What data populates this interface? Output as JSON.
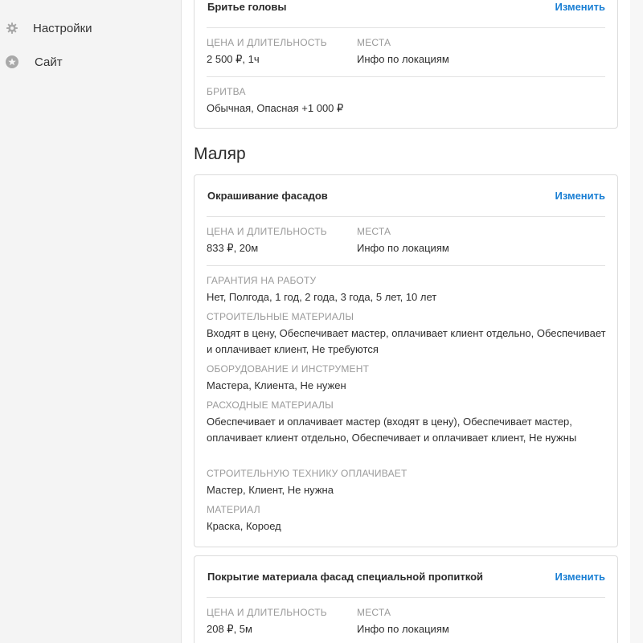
{
  "sidebar": {
    "items": [
      {
        "label": "Настройки",
        "icon": "gear-icon"
      },
      {
        "label": "Сайт",
        "icon": "star-icon"
      }
    ]
  },
  "cards": {
    "shave": {
      "title": "Бритье головы",
      "edit": "Изменить",
      "price_caption": "Цена и длительность",
      "price_value": "2 500 ₽, 1ч",
      "places_caption": "Места",
      "places_value": "Инфо по локациям",
      "extra_caption": "Бритва",
      "extra_value": "Обычная, Опасная +1 000 ₽"
    },
    "facade": {
      "title": "Окрашивание фасадов",
      "edit": "Изменить",
      "price_caption": "Цена и длительность",
      "price_value": "833 ₽, 20м",
      "places_caption": "Места",
      "places_value": "Инфо по локациям",
      "fields": [
        {
          "caption": "Гарантия на работу",
          "value": "Нет, Полгода, 1 год, 2 года, 3 года, 5 лет, 10 лет"
        },
        {
          "caption": "Строительные материалы",
          "value": "Входят в цену, Обеспечивает мастер, оплачивает клиент отдельно, Обеспечивает и оплачивает клиент, Не требуются"
        },
        {
          "caption": "Оборудование и инструмент",
          "value": "Мастера, Клиента, Не нужен"
        },
        {
          "caption": "Расходные материалы",
          "value": "Обеспечивает и оплачивает мастер (входят в цену), Обеспечивает мастер, оплачивает клиент отдельно, Обеспечивает и оплачивает клиент, Не нужны"
        },
        {
          "caption": "Строительную технику оплачивает",
          "value": "Мастер, Клиент, Не нужна"
        },
        {
          "caption": "Материал",
          "value": "Краска, Короед"
        }
      ]
    },
    "coating": {
      "title": "Покрытие материала фасад специальной пропиткой",
      "edit": "Изменить",
      "price_caption": "Цена и длительность",
      "price_value": "208 ₽, 5м",
      "places_caption": "Места",
      "places_value": "Инфо по локациям"
    }
  },
  "section": {
    "title": "Маляр"
  }
}
